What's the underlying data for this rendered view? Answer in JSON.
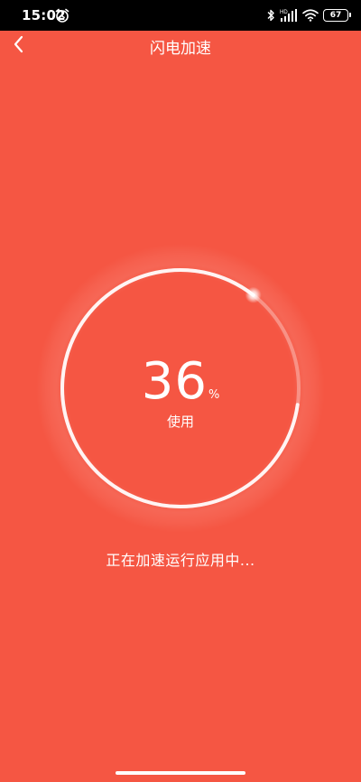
{
  "status_bar": {
    "time": "15:02",
    "battery": "67",
    "icons": [
      "alarm-icon",
      "bluetooth-icon",
      "signal-icon",
      "wifi-icon",
      "battery-icon"
    ]
  },
  "header": {
    "title": "闪电加速",
    "back_icon": "chevron-left-icon"
  },
  "gauge": {
    "value": "36",
    "unit": "%",
    "label": "使用",
    "progress_fraction": 0.36
  },
  "status_text": "正在加速运行应用中...",
  "colors": {
    "background": "#F55643",
    "status_bar": "#000000",
    "foreground": "#FFFFFF"
  }
}
